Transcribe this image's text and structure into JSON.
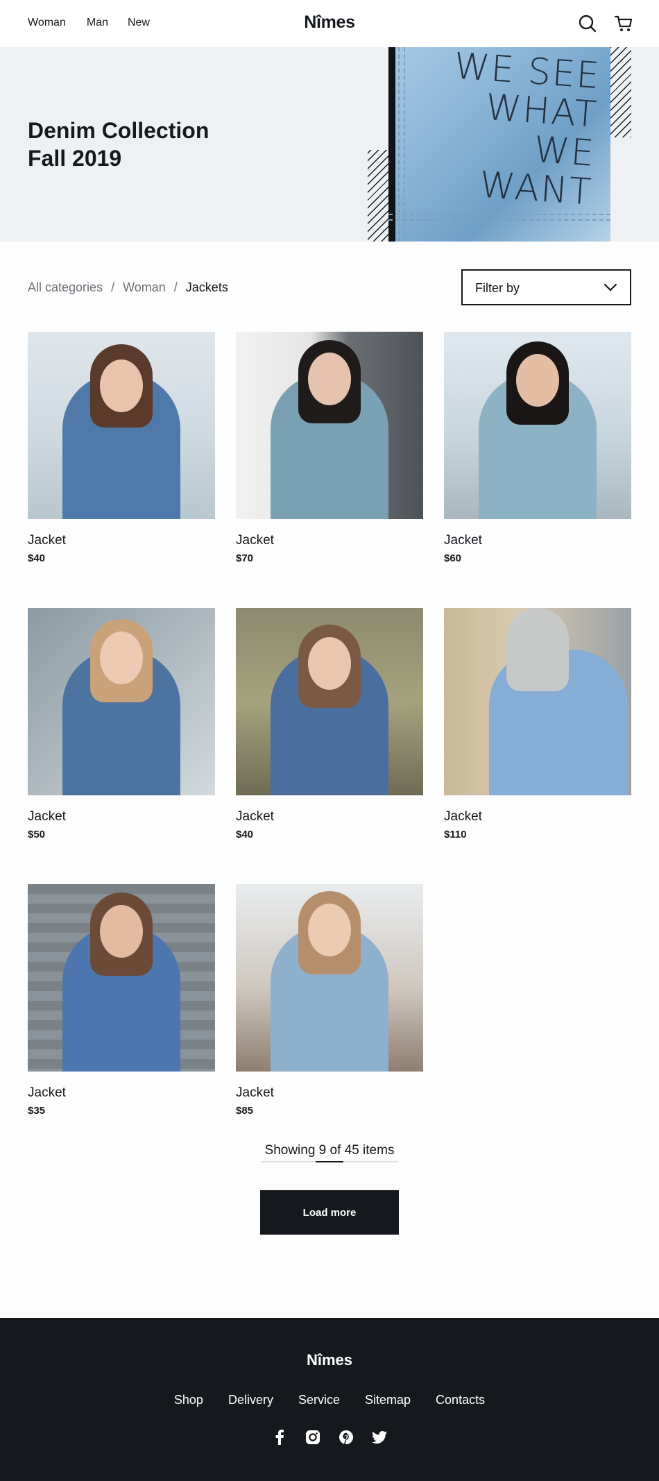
{
  "header": {
    "nav": [
      "Woman",
      "Man",
      "New"
    ],
    "logo": "Nîmes",
    "icons": [
      "search-icon",
      "cart-icon"
    ]
  },
  "hero": {
    "title_line1": "Denim Collection",
    "title_line2": "Fall 2019",
    "image_text": "WE SEE\nWHAT\nWE\nWANT"
  },
  "breadcrumb": {
    "items": [
      "All categories",
      "Woman",
      "Jackets"
    ],
    "separator": "/"
  },
  "filter": {
    "label": "Filter by"
  },
  "products": [
    {
      "name": "Jacket",
      "price": "$40"
    },
    {
      "name": "Jacket",
      "price": "$70"
    },
    {
      "name": "Jacket",
      "price": "$60"
    },
    {
      "name": "Jacket",
      "price": "$50"
    },
    {
      "name": "Jacket",
      "price": "$40"
    },
    {
      "name": "Jacket",
      "price": "$110"
    },
    {
      "name": "Jacket",
      "price": "$35"
    },
    {
      "name": "Jacket",
      "price": "$85"
    }
  ],
  "pagination": {
    "showing_text": "Showing 9 of 45 items",
    "shown": 9,
    "total": 45,
    "load_more_label": "Load more"
  },
  "footer": {
    "logo": "Nîmes",
    "links": [
      "Shop",
      "Delivery",
      "Service",
      "Sitemap",
      "Contacts"
    ],
    "social": [
      "facebook-icon",
      "instagram-icon",
      "pinterest-icon",
      "twitter-icon"
    ]
  },
  "colors": {
    "primary": "#15191d",
    "hero_bg": "#eef0f2",
    "muted_text": "#6b7178",
    "denim": "#6f9fc6"
  }
}
